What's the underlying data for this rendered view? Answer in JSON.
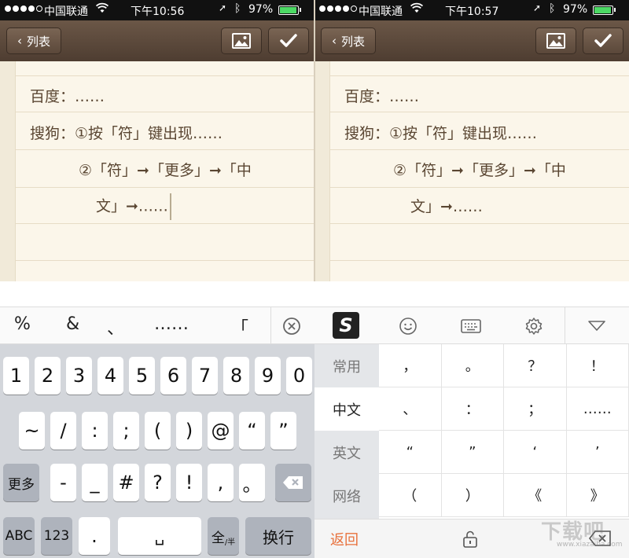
{
  "status_left": {
    "carrier": "中国联通",
    "time": "下午10:56",
    "battery": "97%"
  },
  "status_right": {
    "carrier": "中国联通",
    "time": "下午10:57",
    "battery": "97%"
  },
  "nav": {
    "back_label": "列表"
  },
  "note_left": {
    "lines": [
      "百度：……",
      "搜狗：①按「符」键出现……",
      "②「符」➞「更多」➞「中",
      "文」➞……"
    ]
  },
  "note_right": {
    "lines": [
      "百度：……",
      "搜狗：①按「符」键出现……",
      "②「符」➞「更多」➞「中",
      "文」➞……"
    ]
  },
  "candidates": [
    "%",
    "&",
    "、",
    "……",
    "「"
  ],
  "keyboard_left": {
    "row1": [
      "1",
      "2",
      "3",
      "4",
      "5",
      "6",
      "7",
      "8",
      "9",
      "0"
    ],
    "row2": [
      "~",
      "/",
      ":",
      ";",
      "(",
      ")",
      "@",
      "“",
      "”"
    ],
    "row3_more": "更多",
    "row3": [
      "-",
      "_",
      "#",
      "?",
      "!",
      ",",
      "。"
    ],
    "row4_abc": "ABC",
    "row4_123": "123",
    "row4_dot": ".",
    "row4_space": "␣",
    "row4_full": "全",
    "row4_half": "/半",
    "row4_enter": "换行"
  },
  "sogou": {
    "logo": "S",
    "categories": [
      "常用",
      "中文",
      "英文",
      "网络"
    ],
    "active_category": "中文",
    "symbols": [
      [
        "，",
        "。",
        "？",
        "！"
      ],
      [
        "、",
        "：",
        "；",
        "……"
      ],
      [
        "“",
        "”",
        "‘",
        "’"
      ],
      [
        "（",
        "）",
        "《",
        "》"
      ]
    ],
    "return_label": "返回"
  },
  "watermark": {
    "main": "下载吧",
    "sub": "www.xiazaiba.com"
  },
  "colors": {
    "nav_brown": "#5b483a",
    "paper": "#fbf6ea",
    "accent_orange": "#e8713c",
    "battery_green": "#4cd964"
  }
}
